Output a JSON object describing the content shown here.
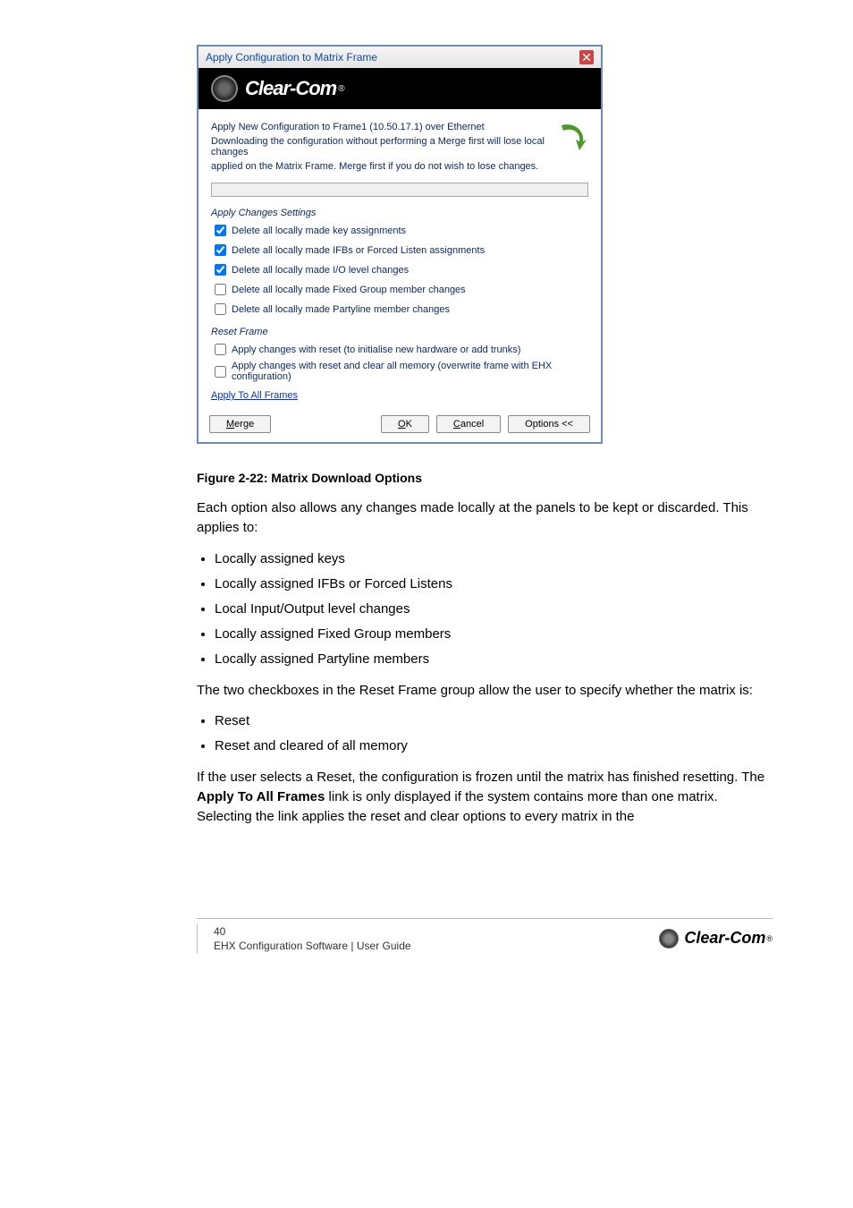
{
  "dialog": {
    "title": "Apply Configuration to Matrix Frame",
    "brand": "Clear-Com",
    "headline": "Apply New Configuration to Frame1 (10.50.17.1) over Ethernet",
    "warn1": "Downloading the configuration without performing a Merge first will lose local changes",
    "warn2": "applied on the Matrix Frame. Merge first if you do not wish to lose changes.",
    "sect_apply": "Apply Changes Settings",
    "chk": {
      "c1": "Delete all locally made key assignments",
      "c2": "Delete all locally made IFBs or Forced Listen assignments",
      "c3": "Delete all locally made I/O level changes",
      "c4": "Delete all locally made Fixed Group member changes",
      "c5": "Delete all locally made Partyline member changes"
    },
    "sect_reset": "Reset Frame",
    "reset": {
      "r1": "Apply changes with reset (to initialise new hardware or add trunks)",
      "r2": "Apply changes with reset and clear all memory (overwrite frame with EHX configuration)"
    },
    "link": "Apply To All Frames",
    "btn_merge": "Merge",
    "btn_ok": "OK",
    "btn_cancel": "Cancel",
    "btn_options": "Options <<"
  },
  "caption": "Figure 2-22: Matrix Download Options",
  "intro1": "Each option also allows any changes made locally at the panels to be kept or discarded. This applies to:",
  "opts1": {
    "o1": "Locally assigned keys",
    "o2": "Locally assigned IFBs or Forced Listens",
    "o3": "Local Input/Output level changes",
    "o4": "Locally assigned Fixed Group members",
    "o5": "Locally assigned Partyline members"
  },
  "intro2": "The two checkboxes in the Reset Frame group allow the user to specify whether the matrix is:",
  "opts2": {
    "o1": "Reset",
    "o2": "Reset and cleared of all memory"
  },
  "intro3_a": "If the user selects a Reset, the configuration is frozen until the matrix has finished resetting. The ",
  "intro3_b": "Apply To All Frames",
  "intro3_c": " link is only displayed if the system contains more than one matrix. Selecting the link applies the reset and clear options to every matrix in the",
  "footer": {
    "pg": "40",
    "doc": "EHX Configuration Software | User Guide",
    "brand": "Clear-Com"
  }
}
